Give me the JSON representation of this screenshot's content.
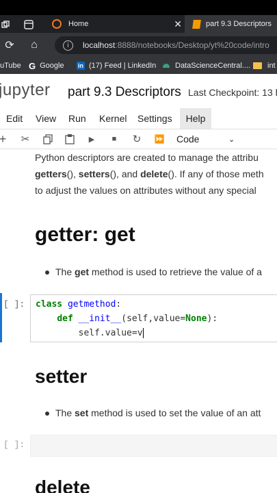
{
  "browser": {
    "tabs": [
      {
        "title": "Home",
        "active": false
      },
      {
        "title": "part 9.3 Descriptors",
        "active": true
      }
    ],
    "url": "localhost:8888/notebooks/Desktop/yt%20code/intro",
    "url_host": "localhost",
    "url_rest": ":8888/notebooks/Desktop/yt%20code/intro",
    "bookmarks": [
      "uTube",
      "Google",
      "(17) Feed | LinkedIn",
      "DataScienceCentral....",
      "int"
    ]
  },
  "jupyter": {
    "logo": "jupyter",
    "notebook_title": "part 9.3 Descriptors",
    "checkpoint": "Last Checkpoint: 13 h",
    "menu": [
      "Edit",
      "View",
      "Run",
      "Kernel",
      "Settings",
      "Help"
    ],
    "cell_type": "Code"
  },
  "cells": {
    "intro_line1": "Python descriptors are created to manage the attribu",
    "intro_line2_parts": [
      "getters",
      "(), ",
      "setters",
      "(), and ",
      "delete",
      "(). If any of those meth"
    ],
    "intro_line3": "to adjust the values on attributes without any special",
    "getter_heading_a": "getter: ",
    "getter_heading_b": "get",
    "getter_bullet_a": "The ",
    "getter_bullet_b": "get",
    "getter_bullet_c": " method is used to retrieve the value of a",
    "prompt": "[ ]:",
    "code_line1_kw": "class",
    "code_line1_name": " getmethod",
    "code_line1_end": ":",
    "code_line2_indent": "    ",
    "code_line2_kw": "def",
    "code_line2_name": " __init__",
    "code_line2_args_a": "(self,value=",
    "code_line2_none": "None",
    "code_line2_args_b": "):",
    "code_line3": "        self.value=v",
    "setter_heading": "setter",
    "setter_bullet_a": "The ",
    "setter_bullet_b": "set",
    "setter_bullet_c": " method is used to set the value of an att",
    "delete_heading": "delete"
  },
  "colors": {
    "tab_bg": "#202124",
    "accent": "#1976d2",
    "jupyter_orange": "#f37726"
  }
}
